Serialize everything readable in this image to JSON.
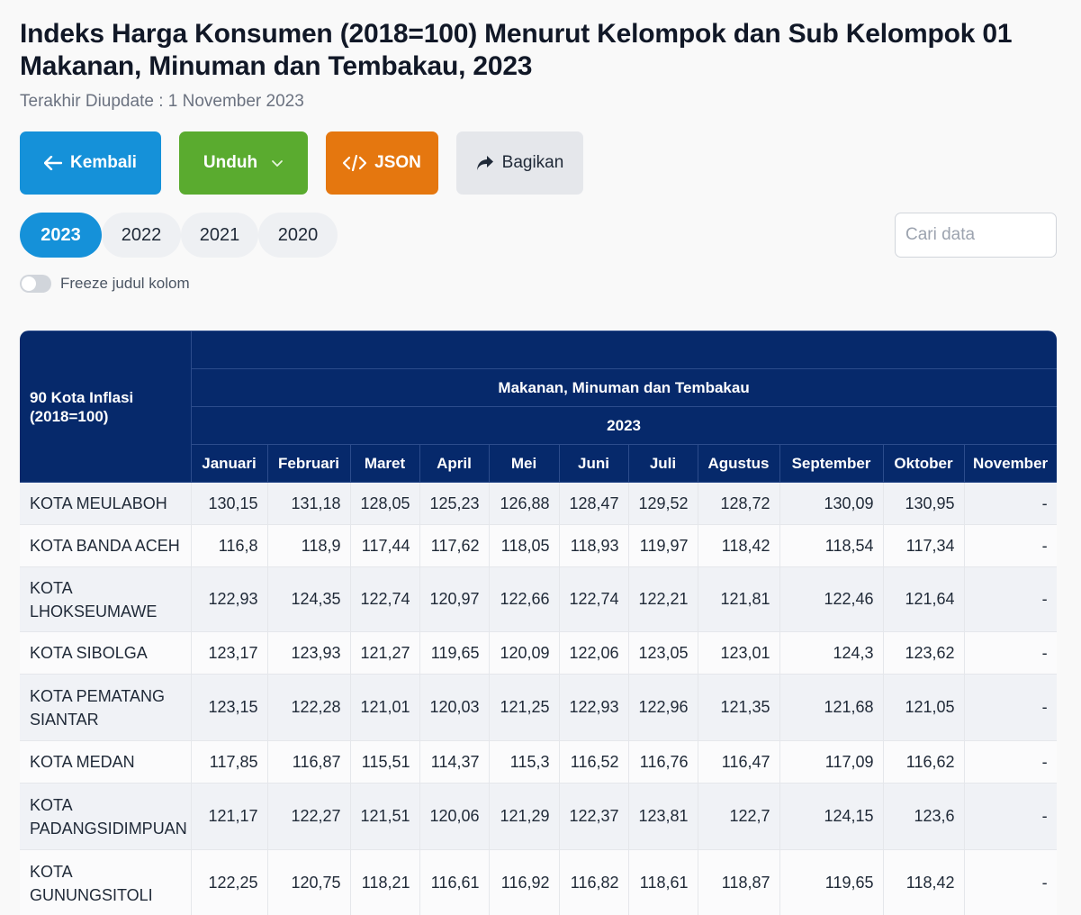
{
  "page": {
    "title": "Indeks Harga Konsumen (2018=100) Menurut Kelompok dan Sub Kelompok 01 Makanan, Minuman dan Tembakau, 2023",
    "updated_label": "Terakhir Diupdate : ",
    "updated_date": "1 November 2023"
  },
  "toolbar": {
    "back_label": "Kembali",
    "download_label": "Unduh",
    "json_label": "JSON",
    "share_label": "Bagikan"
  },
  "years": [
    "2023",
    "2022",
    "2021",
    "2020"
  ],
  "active_year": "2023",
  "search": {
    "placeholder": "Cari data"
  },
  "freeze": {
    "label": "Freeze judul kolom",
    "enabled": false
  },
  "table": {
    "corner_label_line1": "90 Kota Inflasi",
    "corner_label_line2": "(2018=100)",
    "group_label": "Makanan, Minuman dan Tembakau",
    "year_label": "2023",
    "months": [
      "Januari",
      "Februari",
      "Maret",
      "April",
      "Mei",
      "Juni",
      "Juli",
      "Agustus",
      "September",
      "Oktober",
      "November"
    ],
    "rows": [
      {
        "city": "KOTA MEULABOH",
        "values": [
          "130,15",
          "131,18",
          "128,05",
          "125,23",
          "126,88",
          "128,47",
          "129,52",
          "128,72",
          "130,09",
          "130,95",
          "-"
        ]
      },
      {
        "city": "KOTA BANDA ACEH",
        "values": [
          "116,8",
          "118,9",
          "117,44",
          "117,62",
          "118,05",
          "118,93",
          "119,97",
          "118,42",
          "118,54",
          "117,34",
          "-"
        ]
      },
      {
        "city": "KOTA LHOKSEUMAWE",
        "values": [
          "122,93",
          "124,35",
          "122,74",
          "120,97",
          "122,66",
          "122,74",
          "122,21",
          "121,81",
          "122,46",
          "121,64",
          "-"
        ]
      },
      {
        "city": "KOTA SIBOLGA",
        "values": [
          "123,17",
          "123,93",
          "121,27",
          "119,65",
          "120,09",
          "122,06",
          "123,05",
          "123,01",
          "124,3",
          "123,62",
          "-"
        ]
      },
      {
        "city": "KOTA PEMATANG SIANTAR",
        "values": [
          "123,15",
          "122,28",
          "121,01",
          "120,03",
          "121,25",
          "122,93",
          "122,96",
          "121,35",
          "121,68",
          "121,05",
          "-"
        ]
      },
      {
        "city": "KOTA MEDAN",
        "values": [
          "117,85",
          "116,87",
          "115,51",
          "114,37",
          "115,3",
          "116,52",
          "116,76",
          "116,47",
          "117,09",
          "116,62",
          "-"
        ]
      },
      {
        "city": "KOTA PADANGSIDIMPUAN",
        "values": [
          "121,17",
          "122,27",
          "121,51",
          "120,06",
          "121,29",
          "122,37",
          "123,81",
          "122,7",
          "124,15",
          "123,6",
          "-"
        ]
      },
      {
        "city": "KOTA GUNUNGSITOLI",
        "values": [
          "122,25",
          "120,75",
          "118,21",
          "116,61",
          "116,92",
          "116,82",
          "118,61",
          "118,87",
          "119,65",
          "118,42",
          "-"
        ]
      }
    ]
  }
}
